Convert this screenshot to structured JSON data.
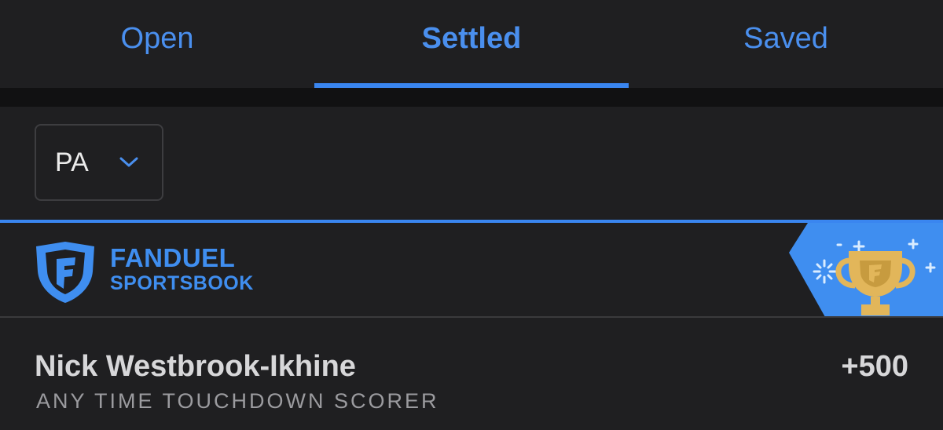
{
  "tabs": [
    {
      "label": "Open",
      "active": false
    },
    {
      "label": "Settled",
      "active": true
    },
    {
      "label": "Saved",
      "active": false
    }
  ],
  "state_filter": {
    "value": "PA",
    "icon": "chevron-down-icon"
  },
  "brand": {
    "line1": "FANDUEL",
    "line2": "SPORTSBOOK",
    "logo_icon": "fanduel-shield-logo",
    "badge_icon": "trophy-icon"
  },
  "bet": {
    "selection": "Nick Westbrook-Ikhine",
    "odds": "+500",
    "market": "ANY TIME TOUCHDOWN SCORER"
  },
  "colors": {
    "accent": "#3a86f0",
    "background": "#1f1f21",
    "badge": "#3f8ef0",
    "trophy": "#e2b65a"
  }
}
